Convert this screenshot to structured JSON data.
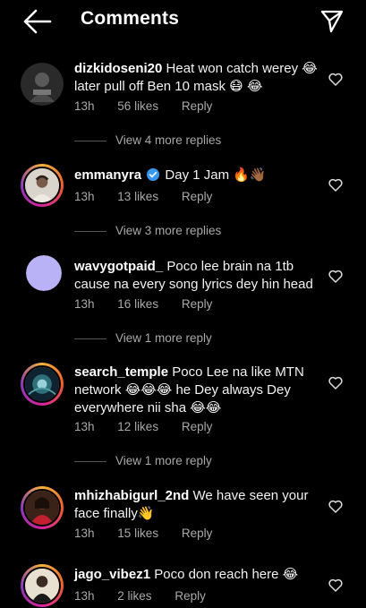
{
  "header": {
    "title": "Comments",
    "back_icon": "arrow-left-icon",
    "send_icon": "paper-plane-icon"
  },
  "comments": [
    {
      "username": "dizkidoseni20",
      "text": "Heat won catch werey 😂 later pull off Ben 10 mask 😷 😂",
      "time": "13h",
      "likes": "56 likes",
      "reply": "Reply",
      "view_replies": "View 4 more replies",
      "avatar_color": "#2a2a2a",
      "story_ring": false
    },
    {
      "username": "emmanyra",
      "verified": true,
      "text": "Day 1 Jam 🔥👋🏾",
      "time": "13h",
      "likes": "13 likes",
      "reply": "Reply",
      "view_replies": "View 3 more replies",
      "avatar_color": "#d9d4cc",
      "story_ring": true
    },
    {
      "username": "wavygotpaid_",
      "text": "Poco lee brain na 1tb cause na every song lyrics dey hin head",
      "time": "13h",
      "likes": "16 likes",
      "reply": "Reply",
      "view_replies": "View 1 more reply",
      "avatar_color": "#b9b2f7",
      "story_ring": false
    },
    {
      "username": "search_temple",
      "text": "Poco Lee na like MTN network 😂😂😂 he Dey always Dey everywhere nii sha 😂😂",
      "time": "13h",
      "likes": "12 likes",
      "reply": "Reply",
      "view_replies": "View 1 more reply",
      "avatar_color": "#1f3a4a",
      "story_ring": true
    },
    {
      "username": "mhizhabigurl_2nd",
      "text": "We have seen your face finally👋",
      "time": "13h",
      "likes": "15 likes",
      "reply": "Reply",
      "avatar_color": "#8a1f2a",
      "story_ring": true
    },
    {
      "username": "jago_vibez1",
      "text": "Poco don reach here 😂",
      "time": "13h",
      "likes": "2 likes",
      "reply": "Reply",
      "avatar_color": "#e8e0d0",
      "story_ring": true
    }
  ]
}
